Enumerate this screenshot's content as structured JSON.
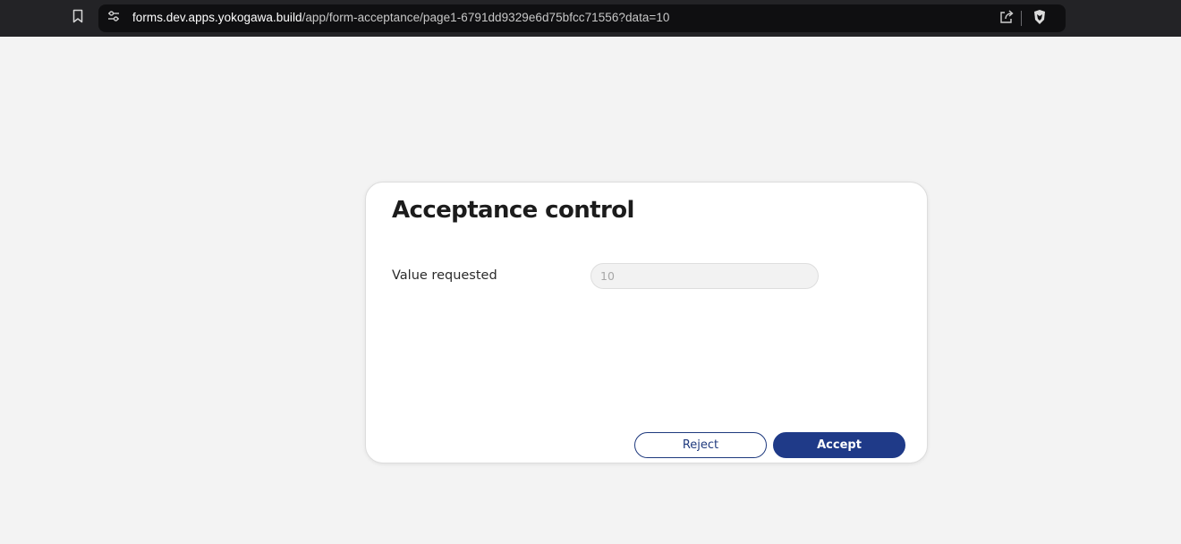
{
  "browser": {
    "url_host": "forms.dev.apps.yokogawa.build",
    "url_path": "/app/form-acceptance/page1-6791dd9329e6d75bfcc71556?data=10",
    "icons": {
      "bookmark": "bookmark-icon",
      "site_info": "site-settings-icon",
      "share": "share-icon",
      "shield": "brave-shield-icon"
    }
  },
  "form": {
    "title": "Acceptance control",
    "field_label": "Value requested",
    "field_value": "10",
    "reject_label": "Reject",
    "accept_label": "Accept"
  },
  "colors": {
    "primary": "#1f3a88",
    "page_background": "#f3f3f3",
    "browser_bar": "#232326",
    "urlbar": "#0f0f11"
  }
}
